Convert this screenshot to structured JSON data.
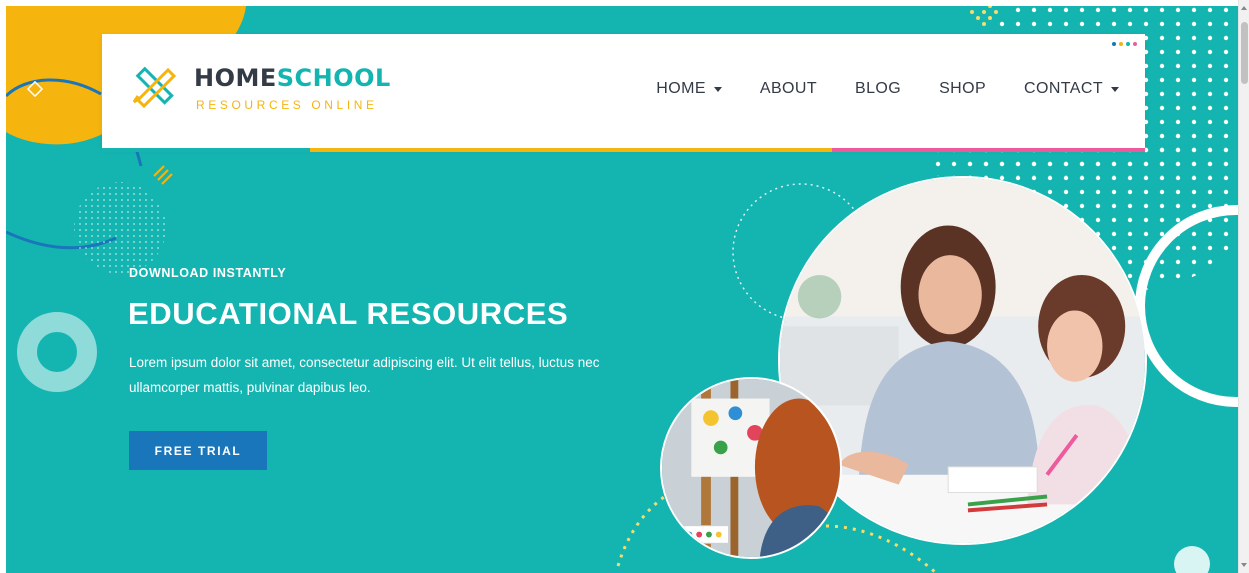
{
  "brand": {
    "title_part1": "HOME",
    "title_part2": "SCHOOL",
    "subtitle": "RESOURCES ONLINE"
  },
  "nav": {
    "items": [
      {
        "label": "HOME",
        "has_dropdown": true
      },
      {
        "label": "ABOUT",
        "has_dropdown": false
      },
      {
        "label": "BLOG",
        "has_dropdown": false
      },
      {
        "label": "SHOP",
        "has_dropdown": false
      },
      {
        "label": "CONTACT",
        "has_dropdown": true
      }
    ]
  },
  "hero": {
    "eyebrow": "DOWNLOAD INSTANTLY",
    "title": "EDUCATIONAL RESOURCES",
    "text": "Lorem ipsum dolor sit amet, consectetur adipiscing elit. Ut elit tellus, luctus nec ullamcorper mattis, pulvinar dapibus leo.",
    "cta_label": "FREE TRIAL"
  },
  "images": {
    "main_photo": "mother-helping-daughter-draw-photo",
    "small_photo": "child-painting-at-easel-photo"
  },
  "colors": {
    "teal": "#14b5b1",
    "yellow": "#f6b40e",
    "pink": "#ef5a9c",
    "blue_button": "#1a76ba",
    "dark_text": "#333b46",
    "white": "#ffffff"
  }
}
